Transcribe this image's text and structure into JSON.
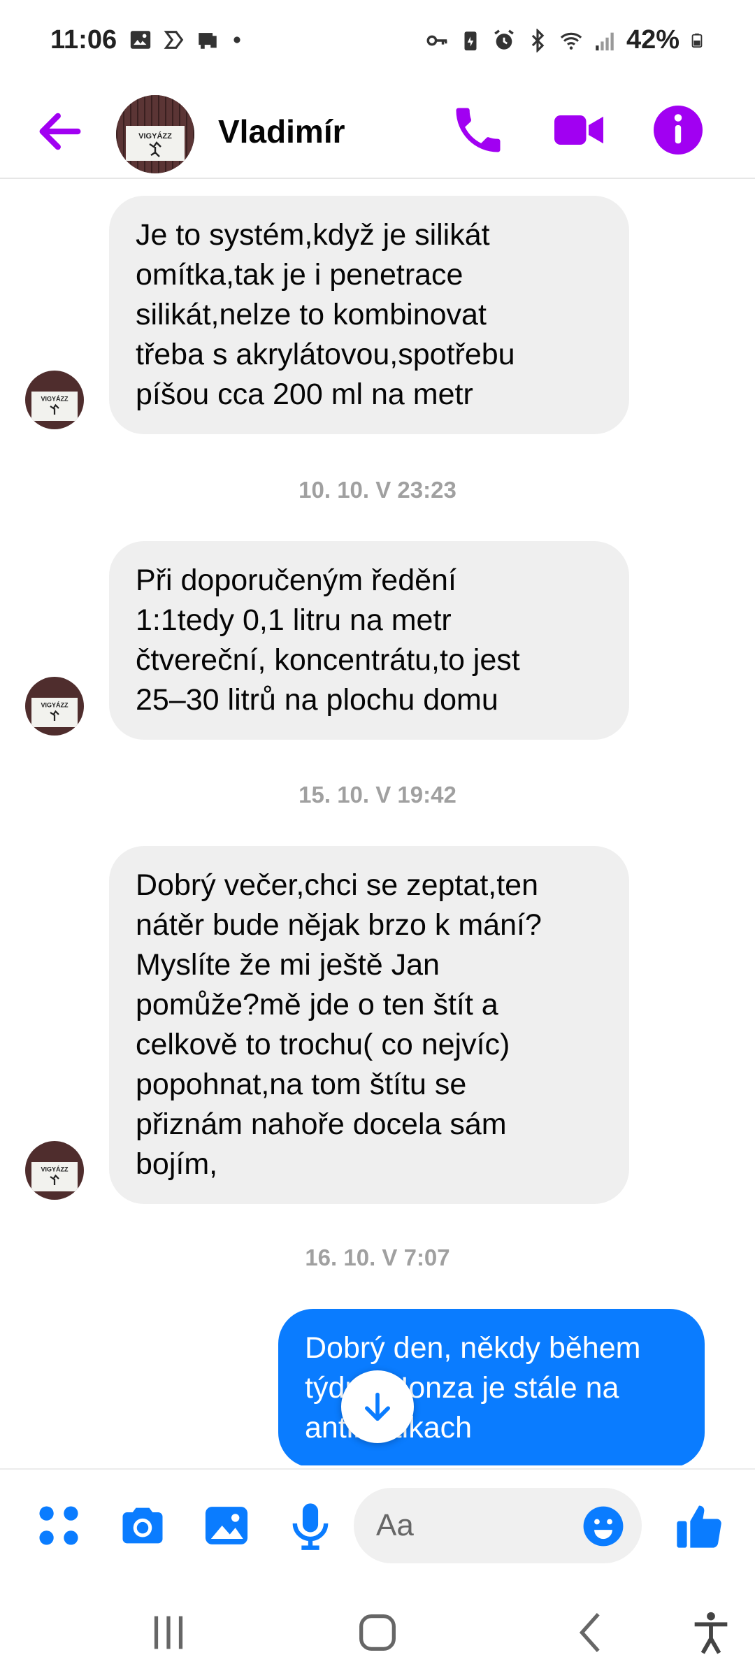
{
  "status_bar": {
    "time": "11:06",
    "battery": "42%",
    "left_icons": [
      "image-icon",
      "bixby-icon",
      "device-icon",
      "dot-icon"
    ],
    "right_icons": [
      "vpn-key-icon",
      "battery-saver-icon",
      "alarm-icon",
      "bluetooth-icon",
      "wifi-icon",
      "signal-icon",
      "battery-icon"
    ]
  },
  "header": {
    "contact_name": "Vladimír",
    "avatar_text": "VIGYÁZZ",
    "accent_color": "#a100f2"
  },
  "messages": [
    {
      "type": "incoming",
      "text": "Je to systém,když je silikát\nomítka,tak je i penetrace\nsilikát,nelze to kombinovat\ntřeba s akrylátovou,spotřebu\npíšou cca 200 ml na metr"
    },
    {
      "type": "timestamp",
      "text": "10. 10. V 23:23"
    },
    {
      "type": "incoming",
      "text": "Při doporučeným ředění\n1:1tedy 0,1 litru na metr\nčtvereční, koncentrátu,to jest\n25–30 litrů na plochu domu"
    },
    {
      "type": "timestamp",
      "text": "15. 10. V 19:42"
    },
    {
      "type": "incoming",
      "text": "Dobrý večer,chci se zeptat,ten\nnátěr bude nějak brzo k mání?\nMyslíte že mi ještě Jan\npomůže?mě jde o ten štít a\ncelkově to trochu( co nejvíc)\npopohnat,na tom štítu se\npřiznám nahoře docela sám\nbojím,"
    },
    {
      "type": "timestamp",
      "text": "16. 10. V 7:07"
    },
    {
      "type": "outgoing",
      "text": "Dobrý den,  někdy během\ntýdne Honza je stále na\nantibiotikach"
    }
  ],
  "composer": {
    "placeholder": "Aa",
    "outgoing_color": "#0a7cff"
  },
  "nav": {
    "icons": [
      "recents-icon",
      "home-icon",
      "back-icon",
      "accessibility-icon"
    ]
  }
}
